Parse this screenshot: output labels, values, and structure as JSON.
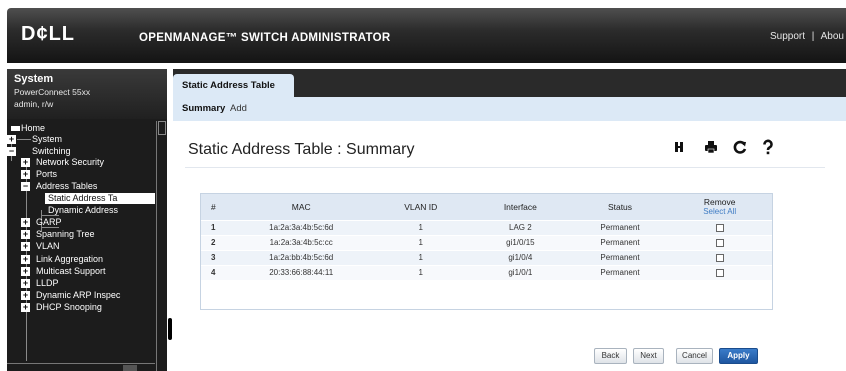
{
  "header": {
    "logo": "D¢LL",
    "product": "OPENMANAGE™ SWITCH ADMINISTRATOR",
    "links": [
      "Support",
      "Abou"
    ],
    "separator": "|"
  },
  "sidebar": {
    "system_title": "System",
    "model": "PowerConnect 55xx",
    "user": "admin, r/w",
    "tree": [
      {
        "label": "Home",
        "level": 0,
        "toggle": "",
        "icon": "home-icon"
      },
      {
        "label": "System",
        "level": 1,
        "toggle": "+"
      },
      {
        "label": "Switching",
        "level": 1,
        "toggle": "−"
      },
      {
        "label": "Network Security",
        "level": 2,
        "toggle": "+"
      },
      {
        "label": "Ports",
        "level": 2,
        "toggle": "+"
      },
      {
        "label": "Address Tables",
        "level": 2,
        "toggle": "−"
      },
      {
        "label": "Static Address Ta",
        "level": 3,
        "toggle": "",
        "selected": true
      },
      {
        "label": "Dynamic Address",
        "level": 3,
        "toggle": ""
      },
      {
        "label": "GARP",
        "level": 2,
        "toggle": "+"
      },
      {
        "label": "Spanning Tree",
        "level": 2,
        "toggle": "+"
      },
      {
        "label": "VLAN",
        "level": 2,
        "toggle": "+"
      },
      {
        "label": "Link Aggregation",
        "level": 2,
        "toggle": "+"
      },
      {
        "label": "Multicast Support",
        "level": 2,
        "toggle": "+"
      },
      {
        "label": "LLDP",
        "level": 2,
        "toggle": "+"
      },
      {
        "label": "Dynamic ARP Inspec",
        "level": 2,
        "toggle": "+"
      },
      {
        "label": "DHCP Snooping",
        "level": 2,
        "toggle": "+"
      }
    ]
  },
  "tabs": {
    "main": "Static Address Table",
    "sub": [
      {
        "label": "Summary",
        "active": true
      },
      {
        "label": "Add",
        "active": false
      }
    ]
  },
  "page": {
    "title": "Static Address Table : Summary",
    "toolbar_icons": [
      "save-icon",
      "print-icon",
      "refresh-icon",
      "help-icon"
    ]
  },
  "table": {
    "columns": [
      "#",
      "MAC",
      "VLAN ID",
      "Interface",
      "Status",
      "Remove"
    ],
    "select_all": "Select All",
    "rows": [
      {
        "num": "1",
        "mac": "1a:2a:3a:4b:5c:6d",
        "vlan": "1",
        "interface": "LAG 2",
        "status": "Permanent",
        "remove": false
      },
      {
        "num": "2",
        "mac": "1a:2a:3a:4b:5c:cc",
        "vlan": "1",
        "interface": "gi1/0/15",
        "status": "Permanent",
        "remove": false
      },
      {
        "num": "3",
        "mac": "1a:2a:bb:4b:5c:6d",
        "vlan": "1",
        "interface": "gi1/0/4",
        "status": "Permanent",
        "remove": false
      },
      {
        "num": "4",
        "mac": "20:33:66:88:44:11",
        "vlan": "1",
        "interface": "gi1/0/1",
        "status": "Permanent",
        "remove": false
      }
    ]
  },
  "buttons": {
    "back": "Back",
    "next": "Next",
    "cancel": "Cancel",
    "apply": "Apply"
  }
}
